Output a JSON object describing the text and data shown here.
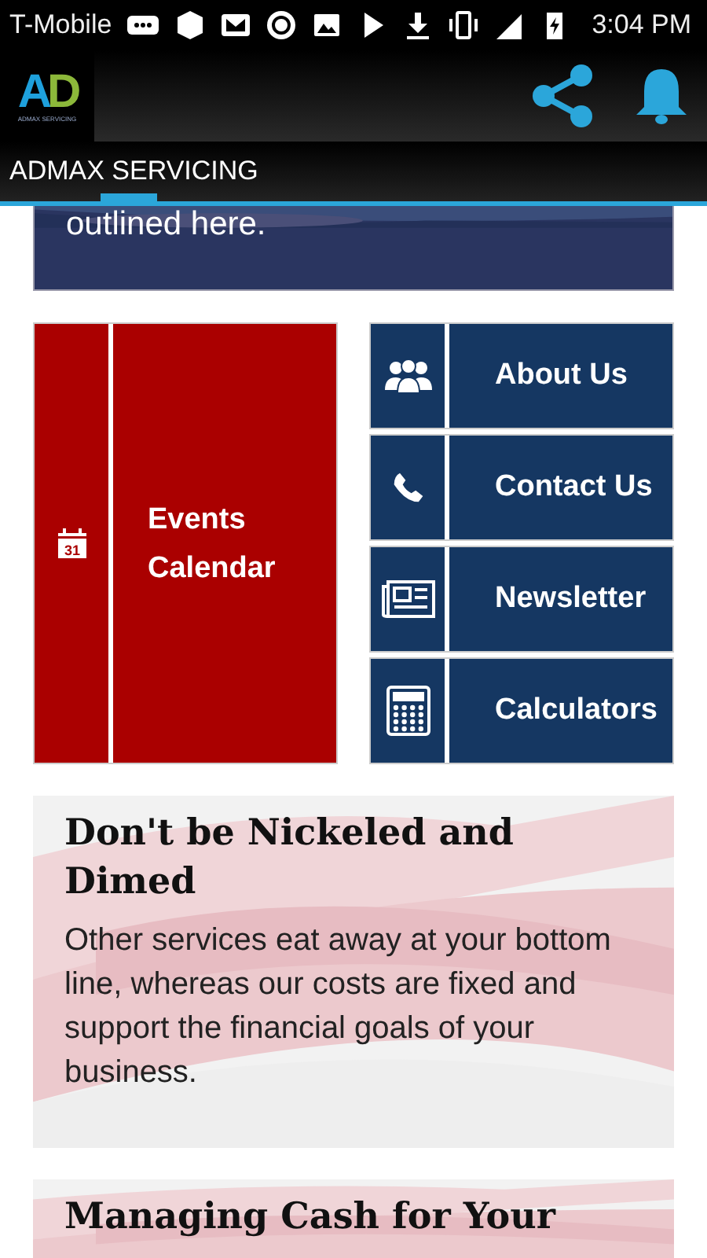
{
  "status_bar": {
    "carrier": "T-Mobile",
    "time": "3:04 PM"
  },
  "app_bar": {
    "logo": {
      "mark": [
        "A",
        "D"
      ],
      "tagline": "ADMAX SERVICING"
    }
  },
  "tabs": [
    {
      "label": "ADMAX SERVICING",
      "selected": true
    }
  ],
  "banner": {
    "text": "outlined here."
  },
  "feature_tile": {
    "label": "Events Calendar",
    "icon_text": "31"
  },
  "tiles": [
    {
      "label": "About Us"
    },
    {
      "label": "Contact Us"
    },
    {
      "label": "Newsletter"
    },
    {
      "label": "Calculators"
    }
  ],
  "cards": [
    {
      "title": "Don't be Nickeled and Dimed",
      "body": "Other services eat away at your bottom line, whereas our costs are fixed and support the financial goals of your business."
    },
    {
      "title": "Managing Cash for Your"
    }
  ]
}
